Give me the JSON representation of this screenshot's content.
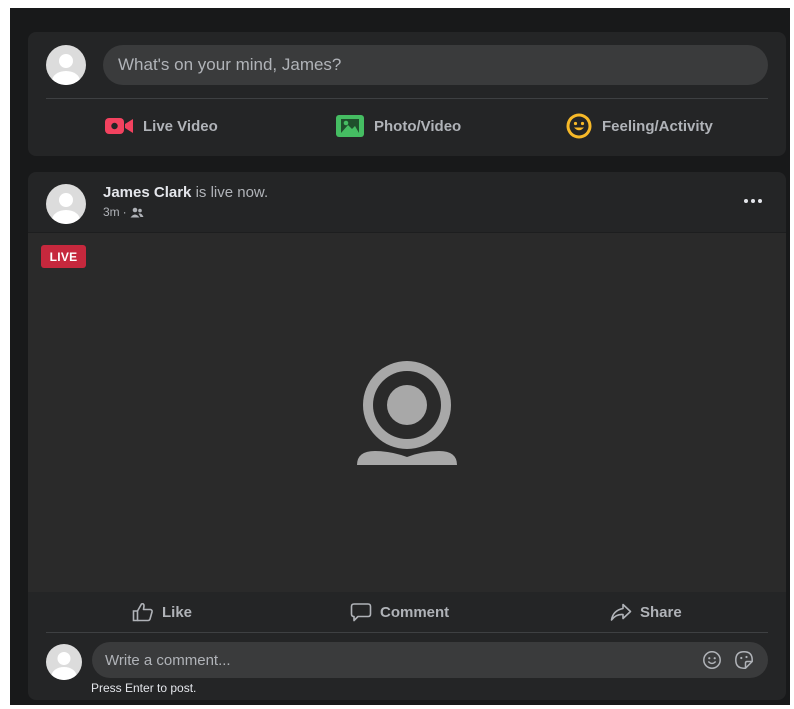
{
  "composer": {
    "placeholder": "What's on your mind, James?",
    "actions": [
      {
        "label": "Live Video",
        "icon": "live-video-icon",
        "color": "#f3425f"
      },
      {
        "label": "Photo/Video",
        "icon": "photo-video-icon",
        "color": "#45bd62"
      },
      {
        "label": "Feeling/Activity",
        "icon": "feeling-icon",
        "color": "#f7b928"
      }
    ]
  },
  "post": {
    "author": "James Clark",
    "status": " is live now.",
    "time": "3m",
    "separator": "·",
    "audience_icon": "friends-icon",
    "badge": "LIVE",
    "badge_color": "#c6283d"
  },
  "actions": [
    {
      "label": "Like",
      "icon": "like-icon"
    },
    {
      "label": "Comment",
      "icon": "comment-icon"
    },
    {
      "label": "Share",
      "icon": "share-icon"
    }
  ],
  "comment": {
    "placeholder": "Write a comment...",
    "hint": "Press Enter to post."
  }
}
